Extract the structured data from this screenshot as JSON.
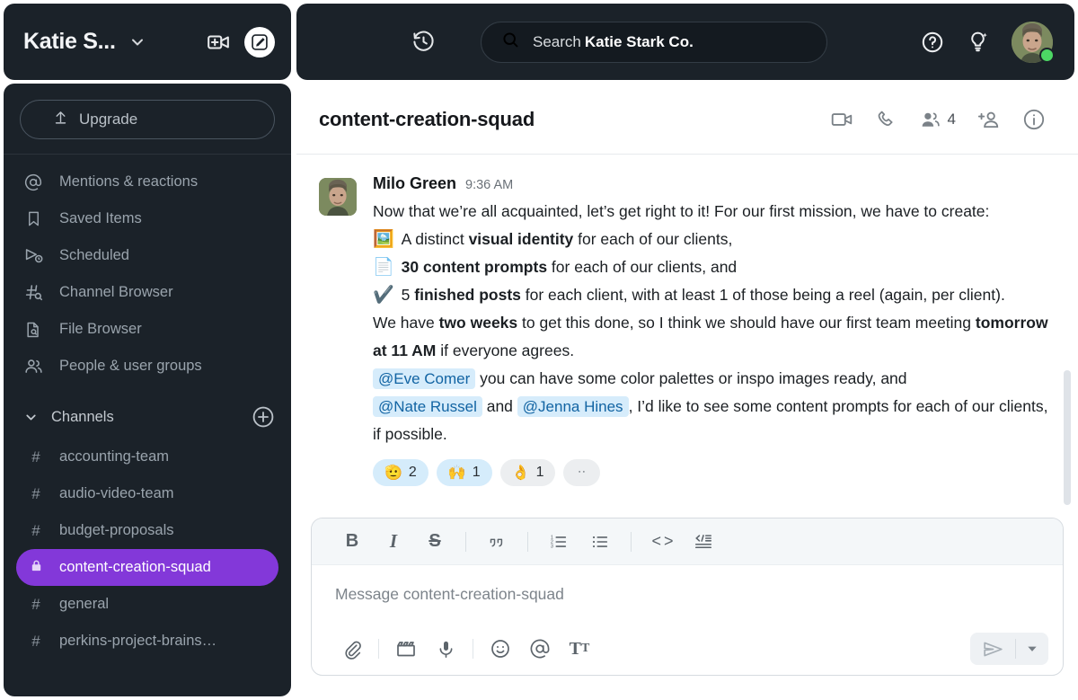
{
  "workspace": {
    "name": "Katie S...",
    "caret_icon": "chevron-down-icon",
    "video_icon": "new-huddle-icon",
    "compose_icon": "compose-icon"
  },
  "topbar": {
    "history_icon": "history-icon",
    "search_icon": "search-icon",
    "search_label": "Search",
    "search_scope": "Katie Stark Co.",
    "help_icon": "help-icon",
    "ai_icon": "lightbulb-sparkle-icon",
    "presence": "online",
    "presence_color": "#4cd764"
  },
  "sidebar": {
    "upgrade_label": "Upgrade",
    "upgrade_icon": "upload-arrow-icon",
    "nav": [
      {
        "label": "Mentions & reactions",
        "icon": "at-icon"
      },
      {
        "label": "Saved Items",
        "icon": "bookmark-icon"
      },
      {
        "label": "Scheduled",
        "icon": "scheduled-send-icon"
      },
      {
        "label": "Channel Browser",
        "icon": "channel-search-icon"
      },
      {
        "label": "File Browser",
        "icon": "file-search-icon"
      },
      {
        "label": "People & user groups",
        "icon": "people-icon"
      }
    ],
    "section": {
      "label": "Channels",
      "chevron_icon": "chevron-down-icon",
      "add_icon": "plus-circle-icon"
    },
    "channels": [
      {
        "label": "accounting-team",
        "icon": "hash-icon",
        "active": false
      },
      {
        "label": "audio-video-team",
        "icon": "hash-icon",
        "active": false
      },
      {
        "label": "budget-proposals",
        "icon": "hash-icon",
        "active": false
      },
      {
        "label": "content-creation-squad",
        "icon": "lock-icon",
        "active": true
      },
      {
        "label": "general",
        "icon": "hash-icon",
        "active": false
      },
      {
        "label": "perkins-project-brains…",
        "icon": "hash-icon",
        "active": false
      }
    ],
    "active_color": "#8338d9"
  },
  "channel": {
    "title": "content-creation-squad",
    "actions": {
      "video_icon": "video-camera-icon",
      "call_icon": "phone-icon",
      "members_icon": "members-icon",
      "member_count": "4",
      "add_person_icon": "add-person-icon",
      "info_icon": "info-icon"
    }
  },
  "message": {
    "author": "Milo Green",
    "time": "9:36 AM",
    "intro": "Now that we’re all acquainted, let’s get right to it! For our first mission, we have to create:",
    "bullets": [
      {
        "emoji": "🖼️",
        "emoji_name": "framed-picture-emoji",
        "pre": "A distinct ",
        "bold": "visual identity",
        "post": " for each of our clients,"
      },
      {
        "emoji": "📄",
        "emoji_name": "page-facing-up-emoji",
        "pre": "",
        "bold": "30 content prompts",
        "post": " for each of our clients, and"
      },
      {
        "emoji": "✔️",
        "emoji_name": "check-mark-emoji",
        "pre": "5 ",
        "bold": "finished posts",
        "post": " for each client, with at least 1 of those being a reel (again, per client)."
      }
    ],
    "deadline_pre": "We have ",
    "deadline_bold": "two weeks",
    "deadline_mid": " to get this done, so I think we should have our first team meeting ",
    "deadline_bold2": "tomorrow at 11 AM",
    "deadline_post": " if everyone agrees.",
    "mention1": "@Eve Comer",
    "mention1_post": " you can have some color palettes or inspo images ready, and",
    "mention2": "@Nate Russel",
    "mention_and": " and ",
    "mention3": "@Jenna Hines",
    "mention3_post": ", I’d like to see some content prompts for each of our clients, if possible.",
    "reactions": [
      {
        "emoji": "🫡",
        "emoji_name": "saluting-face-emoji",
        "count": "2",
        "mine": true
      },
      {
        "emoji": "🙌",
        "emoji_name": "raising-hands-emoji",
        "count": "1",
        "mine": true
      },
      {
        "emoji": "👌",
        "emoji_name": "ok-hand-emoji",
        "count": "1",
        "mine": false
      }
    ],
    "add_reaction_icon": "add-reaction-icon"
  },
  "composer": {
    "placeholder": "Message content-creation-squad",
    "format_buttons": [
      {
        "name": "bold-button",
        "label": "B"
      },
      {
        "name": "italic-button",
        "label": "I"
      },
      {
        "name": "strikethrough-button",
        "label": "S"
      },
      {
        "name": "blockquote-button",
        "label": "❞"
      },
      {
        "name": "ordered-list-button",
        "label": ""
      },
      {
        "name": "bulleted-list-button",
        "label": ""
      },
      {
        "name": "code-button",
        "label": "< >"
      },
      {
        "name": "code-block-button",
        "label": ""
      }
    ],
    "action_buttons": [
      {
        "name": "attach-button",
        "icon": "paperclip-icon"
      },
      {
        "name": "video-clip-button",
        "icon": "video-clip-icon"
      },
      {
        "name": "audio-clip-button",
        "icon": "microphone-icon"
      },
      {
        "name": "emoji-button",
        "icon": "smiley-icon"
      },
      {
        "name": "mention-button",
        "icon": "at-icon"
      },
      {
        "name": "formatting-button",
        "icon": "text-format-icon"
      }
    ],
    "send_icon": "send-icon",
    "send_options_icon": "chevron-down-icon"
  }
}
